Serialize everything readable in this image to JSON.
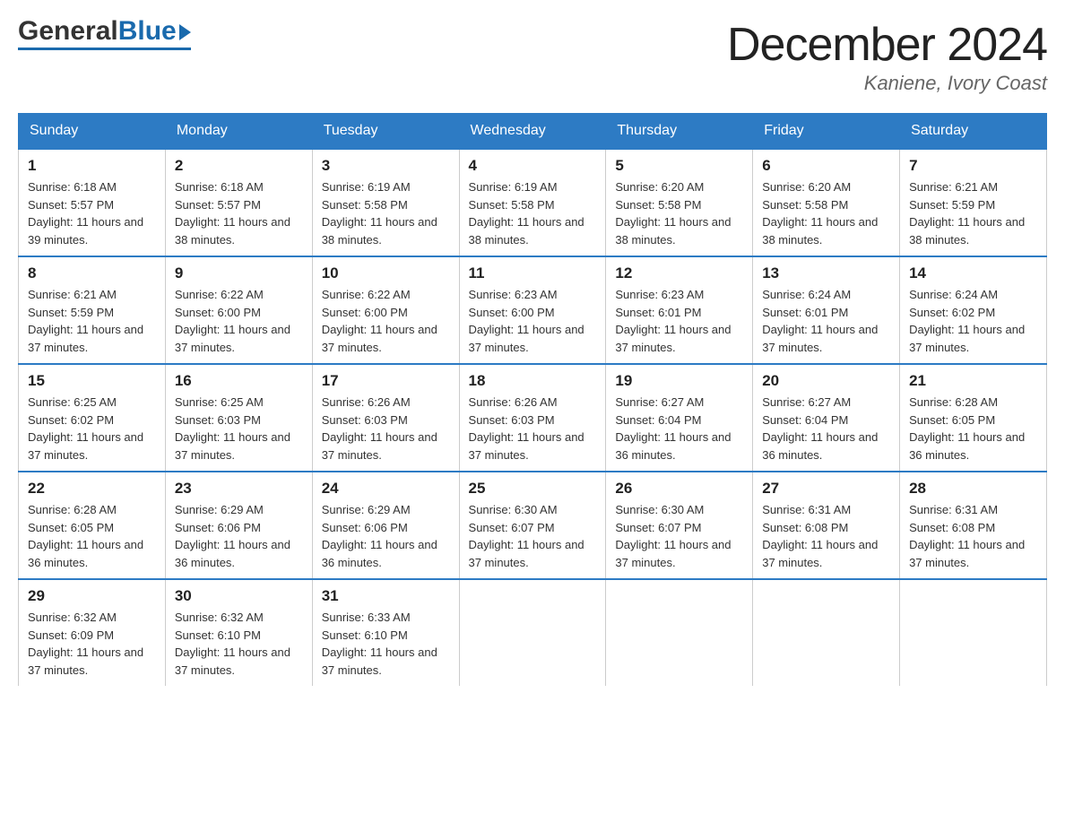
{
  "header": {
    "logo": {
      "general": "General",
      "blue": "Blue"
    },
    "title": "December 2024",
    "location": "Kaniene, Ivory Coast"
  },
  "calendar": {
    "days_of_week": [
      "Sunday",
      "Monday",
      "Tuesday",
      "Wednesday",
      "Thursday",
      "Friday",
      "Saturday"
    ],
    "weeks": [
      [
        {
          "day": "1",
          "sunrise": "6:18 AM",
          "sunset": "5:57 PM",
          "daylight": "11 hours and 39 minutes."
        },
        {
          "day": "2",
          "sunrise": "6:18 AM",
          "sunset": "5:57 PM",
          "daylight": "11 hours and 38 minutes."
        },
        {
          "day": "3",
          "sunrise": "6:19 AM",
          "sunset": "5:58 PM",
          "daylight": "11 hours and 38 minutes."
        },
        {
          "day": "4",
          "sunrise": "6:19 AM",
          "sunset": "5:58 PM",
          "daylight": "11 hours and 38 minutes."
        },
        {
          "day": "5",
          "sunrise": "6:20 AM",
          "sunset": "5:58 PM",
          "daylight": "11 hours and 38 minutes."
        },
        {
          "day": "6",
          "sunrise": "6:20 AM",
          "sunset": "5:58 PM",
          "daylight": "11 hours and 38 minutes."
        },
        {
          "day": "7",
          "sunrise": "6:21 AM",
          "sunset": "5:59 PM",
          "daylight": "11 hours and 38 minutes."
        }
      ],
      [
        {
          "day": "8",
          "sunrise": "6:21 AM",
          "sunset": "5:59 PM",
          "daylight": "11 hours and 37 minutes."
        },
        {
          "day": "9",
          "sunrise": "6:22 AM",
          "sunset": "6:00 PM",
          "daylight": "11 hours and 37 minutes."
        },
        {
          "day": "10",
          "sunrise": "6:22 AM",
          "sunset": "6:00 PM",
          "daylight": "11 hours and 37 minutes."
        },
        {
          "day": "11",
          "sunrise": "6:23 AM",
          "sunset": "6:00 PM",
          "daylight": "11 hours and 37 minutes."
        },
        {
          "day": "12",
          "sunrise": "6:23 AM",
          "sunset": "6:01 PM",
          "daylight": "11 hours and 37 minutes."
        },
        {
          "day": "13",
          "sunrise": "6:24 AM",
          "sunset": "6:01 PM",
          "daylight": "11 hours and 37 minutes."
        },
        {
          "day": "14",
          "sunrise": "6:24 AM",
          "sunset": "6:02 PM",
          "daylight": "11 hours and 37 minutes."
        }
      ],
      [
        {
          "day": "15",
          "sunrise": "6:25 AM",
          "sunset": "6:02 PM",
          "daylight": "11 hours and 37 minutes."
        },
        {
          "day": "16",
          "sunrise": "6:25 AM",
          "sunset": "6:03 PM",
          "daylight": "11 hours and 37 minutes."
        },
        {
          "day": "17",
          "sunrise": "6:26 AM",
          "sunset": "6:03 PM",
          "daylight": "11 hours and 37 minutes."
        },
        {
          "day": "18",
          "sunrise": "6:26 AM",
          "sunset": "6:03 PM",
          "daylight": "11 hours and 37 minutes."
        },
        {
          "day": "19",
          "sunrise": "6:27 AM",
          "sunset": "6:04 PM",
          "daylight": "11 hours and 36 minutes."
        },
        {
          "day": "20",
          "sunrise": "6:27 AM",
          "sunset": "6:04 PM",
          "daylight": "11 hours and 36 minutes."
        },
        {
          "day": "21",
          "sunrise": "6:28 AM",
          "sunset": "6:05 PM",
          "daylight": "11 hours and 36 minutes."
        }
      ],
      [
        {
          "day": "22",
          "sunrise": "6:28 AM",
          "sunset": "6:05 PM",
          "daylight": "11 hours and 36 minutes."
        },
        {
          "day": "23",
          "sunrise": "6:29 AM",
          "sunset": "6:06 PM",
          "daylight": "11 hours and 36 minutes."
        },
        {
          "day": "24",
          "sunrise": "6:29 AM",
          "sunset": "6:06 PM",
          "daylight": "11 hours and 36 minutes."
        },
        {
          "day": "25",
          "sunrise": "6:30 AM",
          "sunset": "6:07 PM",
          "daylight": "11 hours and 37 minutes."
        },
        {
          "day": "26",
          "sunrise": "6:30 AM",
          "sunset": "6:07 PM",
          "daylight": "11 hours and 37 minutes."
        },
        {
          "day": "27",
          "sunrise": "6:31 AM",
          "sunset": "6:08 PM",
          "daylight": "11 hours and 37 minutes."
        },
        {
          "day": "28",
          "sunrise": "6:31 AM",
          "sunset": "6:08 PM",
          "daylight": "11 hours and 37 minutes."
        }
      ],
      [
        {
          "day": "29",
          "sunrise": "6:32 AM",
          "sunset": "6:09 PM",
          "daylight": "11 hours and 37 minutes."
        },
        {
          "day": "30",
          "sunrise": "6:32 AM",
          "sunset": "6:10 PM",
          "daylight": "11 hours and 37 minutes."
        },
        {
          "day": "31",
          "sunrise": "6:33 AM",
          "sunset": "6:10 PM",
          "daylight": "11 hours and 37 minutes."
        },
        null,
        null,
        null,
        null
      ]
    ]
  }
}
